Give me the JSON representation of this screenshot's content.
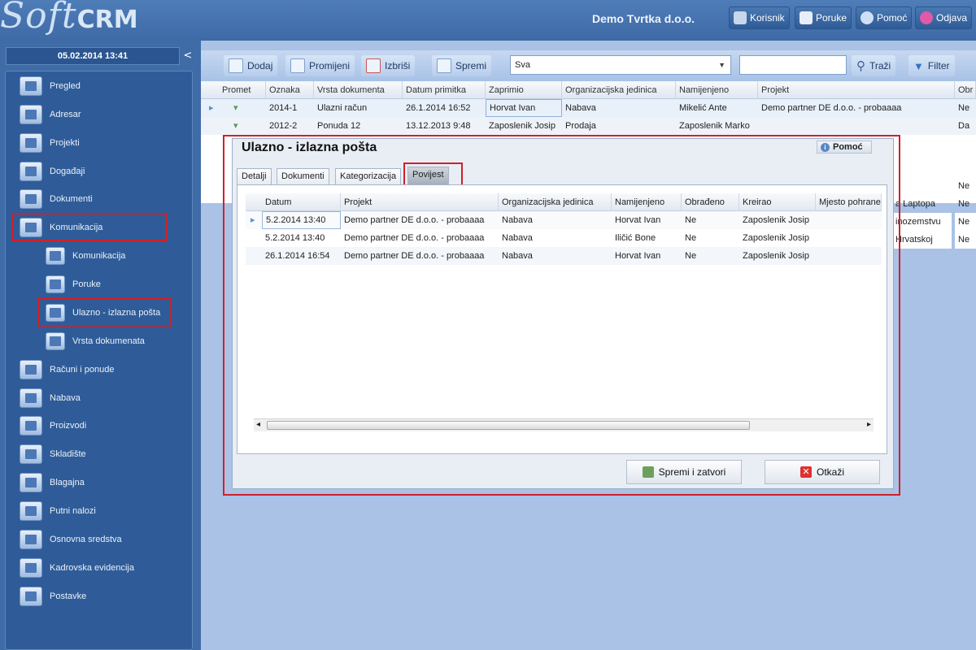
{
  "header": {
    "logo_script": "Soft",
    "logo_bold": "CRM",
    "company": "Demo Tvrtka d.o.o.",
    "buttons": [
      {
        "label": "Korisnik",
        "icon": "user-icon"
      },
      {
        "label": "Poruke",
        "icon": "messages-icon"
      },
      {
        "label": "Pomoć",
        "icon": "info-icon"
      },
      {
        "label": "Odjava",
        "icon": "power-icon"
      }
    ]
  },
  "sidebar": {
    "datetime": "05.02.2014 13:41",
    "collapse": "<",
    "items": [
      {
        "label": "Pregled"
      },
      {
        "label": "Adresar"
      },
      {
        "label": "Projekti"
      },
      {
        "label": "Događaji"
      },
      {
        "label": "Dokumenti"
      },
      {
        "label": "Komunikacija"
      },
      {
        "label": "Komunikacija"
      },
      {
        "label": "Poruke"
      },
      {
        "label": "Ulazno - izlazna pošta"
      },
      {
        "label": "Vrsta dokumenata"
      },
      {
        "label": "Računi i ponude"
      },
      {
        "label": "Nabava"
      },
      {
        "label": "Proizvodi"
      },
      {
        "label": "Skladište"
      },
      {
        "label": "Blagajna"
      },
      {
        "label": "Putni nalozi"
      },
      {
        "label": "Osnovna sredstva"
      },
      {
        "label": "Kadrovska evidencija"
      },
      {
        "label": "Postavke"
      }
    ]
  },
  "toolbar": {
    "add": "Dodaj",
    "edit": "Promijeni",
    "delete": "Izbriši",
    "save": "Spremi",
    "filter_select": "Sva",
    "search": "Traži",
    "filter": "Filter"
  },
  "grid": {
    "columns": [
      "Promet",
      "Oznaka",
      "Vrsta dokumenta",
      "Datum primitka",
      "Zaprimio",
      "Organizacijska jedinica",
      "Namijenjeno",
      "Projekt",
      "Obr"
    ],
    "rows": [
      [
        "2014-1",
        "Ulazni račun",
        "26.1.2014 16:52",
        "Horvat Ivan",
        "Nabava",
        "Mikelić Ante",
        "Demo partner DE d.o.o. - probaaaa",
        "Ne"
      ],
      [
        "2012-2",
        "Ponuda 12",
        "13.12.2013 9:48",
        "Zaposlenik Josip",
        "Prodaja",
        "Zaposlenik Marko",
        "",
        "Da"
      ]
    ],
    "partial": [
      "",
      "Ne",
      "a Laptopa",
      "Ne",
      "inozemstvu",
      "Ne",
      "Hrvatskoj",
      "Ne"
    ]
  },
  "dialog": {
    "title": "Ulazno - izlazna pošta",
    "help": "Pomoć",
    "tabs": [
      "Detalji",
      "Dokumenti",
      "Kategorizacija",
      "Povijest"
    ],
    "columns": [
      "Datum",
      "Projekt",
      "Organizacijska jedinica",
      "Namijenjeno",
      "Obrađeno",
      "Kreirao",
      "Mjesto pohrane"
    ],
    "rows": [
      [
        "5.2.2014 13:40",
        "Demo partner DE d.o.o. - probaaaa",
        "Nabava",
        "Horvat Ivan",
        "Ne",
        "Zaposlenik Josip",
        ""
      ],
      [
        "5.2.2014 13:40",
        "Demo partner DE d.o.o. - probaaaa",
        "Nabava",
        "Iličić  Bone",
        "Ne",
        "Zaposlenik Josip",
        ""
      ],
      [
        "26.1.2014 16:54",
        "Demo partner DE d.o.o. - probaaaa",
        "Nabava",
        "Horvat Ivan",
        "Ne",
        "Zaposlenik Josip",
        ""
      ]
    ],
    "save_close": "Spremi i zatvori",
    "cancel": "Otkaži",
    "scroll_left": "◂",
    "scroll_right": "▸",
    "row_marker": "▸"
  },
  "colors": {
    "highlight": "#d0202a",
    "sidebar": "#3f6ba7",
    "accent": "#4d78b6"
  }
}
